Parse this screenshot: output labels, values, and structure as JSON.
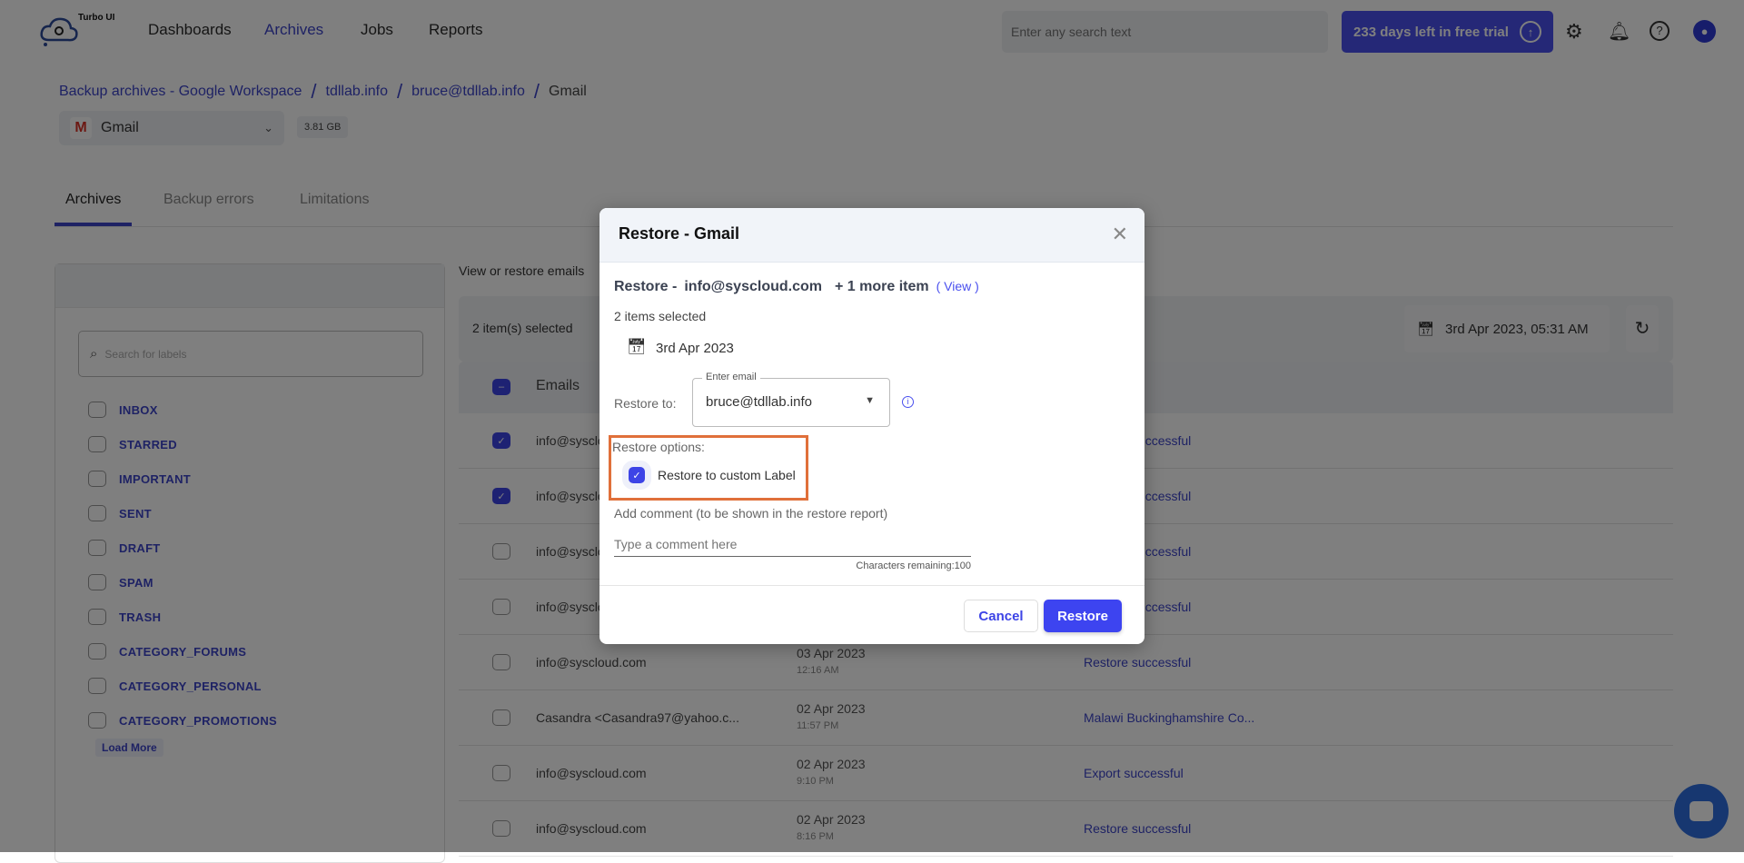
{
  "app": {
    "logo_text": "Turbo UI"
  },
  "nav": {
    "items": [
      "Dashboards",
      "Archives",
      "Jobs",
      "Reports"
    ],
    "active": "Archives"
  },
  "header": {
    "search_placeholder": "Enter any search text",
    "trial_label": "233 days left in free trial",
    "icons": [
      "upload-circle-icon",
      "gear-icon",
      "bell-icon",
      "help-icon",
      "user-avatar-icon"
    ]
  },
  "breadcrumb": [
    "Backup archives - Google Workspace",
    "tdllab.info",
    "bruce@tdllab.info",
    "Gmail"
  ],
  "service": {
    "selected": "Gmail",
    "size": "3.81 GB"
  },
  "tabs": [
    "Archives",
    "Backup errors",
    "Limitations"
  ],
  "labels": {
    "search_placeholder": "Search for labels",
    "items": [
      "INBOX",
      "STARRED",
      "IMPORTANT",
      "SENT",
      "DRAFT",
      "SPAM",
      "TRASH",
      "CATEGORY_FORUMS",
      "CATEGORY_PERSONAL",
      "CATEGORY_PROMOTIONS"
    ],
    "load_more": "Load More"
  },
  "emails": {
    "title": "View or restore emails",
    "selected_count": "2 item(s) selected",
    "snapshot_date": "3rd Apr 2023, 05:31 AM",
    "column_emails": "Emails",
    "rows": [
      {
        "email": "info@syscloud.com",
        "date": "",
        "time": "",
        "status": "Restore successful",
        "checked": true
      },
      {
        "email": "info@syscloud.com",
        "date": "",
        "time": "",
        "status": "Restore successful",
        "checked": true
      },
      {
        "email": "info@syscloud.com",
        "date": "",
        "time": "",
        "status": "Restore successful",
        "checked": false
      },
      {
        "email": "info@syscloud.com",
        "date": "",
        "time": "",
        "status": "Restore successful",
        "checked": false
      },
      {
        "email": "info@syscloud.com",
        "date": "03 Apr 2023",
        "time": "12:16 AM",
        "status": "Restore successful",
        "checked": false
      },
      {
        "email": "Casandra <Casandra97@yahoo.c...",
        "date": "02 Apr 2023",
        "time": "11:57 PM",
        "status": "Malawi Buckinghamshire Co...",
        "checked": false
      },
      {
        "email": "info@syscloud.com",
        "date": "02 Apr 2023",
        "time": "9:10 PM",
        "status": "Export successful",
        "checked": false
      },
      {
        "email": "info@syscloud.com",
        "date": "02 Apr 2023",
        "time": "8:16 PM",
        "status": "Restore successful",
        "checked": false
      }
    ]
  },
  "dialog": {
    "title": "Restore - Gmail",
    "summary_prefix": "Restore -",
    "summary_email": "info@syscloud.com",
    "summary_more": "+ 1 more item",
    "view_link": "( View )",
    "items_selected": "2 items selected",
    "date": "3rd Apr 2023",
    "restore_to_label": "Restore to:",
    "email_field_label": "Enter email",
    "email_value": "bruce@tdllab.info",
    "options_label": "Restore options:",
    "custom_label_option": "Restore to custom Label",
    "custom_label_checked": true,
    "comment_label": "Add comment (to be shown in the restore report)",
    "comment_placeholder": "Type a comment here",
    "chars_remaining": "Characters remaining:100",
    "cancel": "Cancel",
    "restore": "Restore"
  },
  "colors": {
    "accent": "#3d44e6",
    "highlight_box": "#e0703a"
  }
}
